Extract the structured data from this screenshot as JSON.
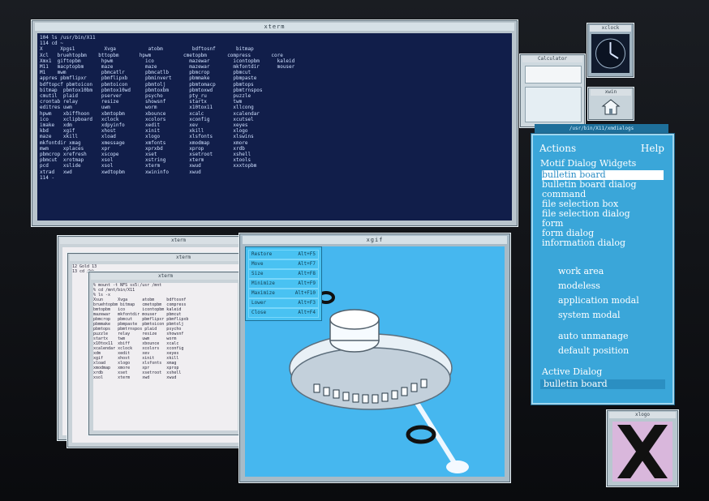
{
  "xterm_main": {
    "title": "xterm",
    "lines": [
      "104 ls /usr/bin/X11",
      "114 cd ~",
      "X      Xpgs1          Xvga           atobm          bdftosnf       bitmap",
      "Xcl   bruehtopbm    bttopbm       hpwm           cmetopbm       compress       core",
      "Xmx1  giftopbm       hpwm           ico            mazewar        icontopbm      kaleid",
      "M11   macptopbm      maze           maze           mazewar        mkfontdir      mouser",
      "M1    mwm            pbmcatlr       pbmcatlb       pbmcrop        pbmcut",
      "appres pbmflipxr     pbmflipxb      pbminvert      pbmmake        pbmpaste",
      "bdftopcf pbmtoicon   pbmtoicon      pbmtolj        pbmtomacp      pbmtops",
      "bitmap  pbmtox10bm   pbmtox10wd     pbmtoxbm       pbmtoxwd       pbmtrnspos",
      "cmutil  plaid        pserver        psycho         pty_ru         puzzle",
      "crontab relay        resize         showsnf        startx         twm",
      "editres uwm          uwm            worm           x10tox11       xllcong",
      "hpwm    xbiffhoon    xbmtopbm       xbounce        xcalc          xcalendar",
      "ico     xclipboard   xclock         xcolors        xconfig        xcutsel",
      "imake   xdm          xdpyinfo       xedit          xev            xeyes",
      "kbd     xgif         xhost          xinit          xkill          xlogo",
      "maze    xkill        xload          xlogo          xlsfonts       xlswins",
      "mkfontdir xmag       xmessage       xmfonts        xmodmap        xmore",
      "mwm     xplaces      xpr            xprxbd         xprop          xrdb",
      "pbmcrop xrefresh     xscope         xset           xsetroot       xshell",
      "pbmcut  xrotmap      xsol           xstring        xterm          xtools",
      "pcd     xslide       xsol           xterm          xwud           xxxtopbm",
      "xtrad   xwd          xwdtopbm       xwininfo       xwud",
      "114 -"
    ]
  },
  "clock": {
    "title": "xclock"
  },
  "calculator": {
    "title": "Calculator"
  },
  "small_tool": {
    "title": "xwin"
  },
  "motif_window": {
    "title": "/usr/bin/X11/xmdialogs",
    "menu_actions": "Actions",
    "menu_help": "Help",
    "section1": "Motif Dialog Widgets",
    "items": [
      "bulletin board",
      "bulletin board dialog",
      "command",
      "file selection box",
      "file selection dialog",
      "form",
      "form dialog",
      "information dialog"
    ],
    "options": [
      "work area",
      "modeless",
      "application modal",
      "system modal"
    ],
    "flags": [
      "auto unmanage",
      "default position"
    ],
    "active_label": "Active Dialog",
    "active_value": "bulletin board"
  },
  "xgif_window": {
    "title": "xgif",
    "menu": [
      {
        "label": "Restore",
        "key": "Alt+F5"
      },
      {
        "label": "Move",
        "key": "Alt+F7"
      },
      {
        "label": "Size",
        "key": "Alt+F8"
      },
      {
        "label": "Minimize",
        "key": "Alt+F9"
      },
      {
        "label": "Maximize",
        "key": "Alt+F10"
      },
      {
        "label": "Lower",
        "key": "Alt+F3"
      },
      {
        "label": "Close",
        "key": "Alt+F4"
      }
    ]
  },
  "left_terms": {
    "title_back": "xterm",
    "title_mid": "xterm",
    "title_front": "xterm",
    "mid_lines": [
      "12 Gold 13",
      "13 cd /bk"
    ],
    "front_lines": [
      "% mount -t NFS ss5:/usr /mnt",
      "% cd /mnt/bin/X11",
      "% ls -x",
      "Xsun      Xvga      atobm     bdftosnf",
      "bruehtopbm bitmap   cmetopbm  compress",
      "bmtopbm   ico       icontopbm kaleid",
      "mazewar   mkfontdir mouser    pbmcut",
      "pbmcrop   pbmcut    pbmflipxr pbmflipxb",
      "pbmmake   pbmpaste  pbmtoicon pbmtolj",
      "pbmtops   pbmtrnspos plaid    psycho",
      "puzzle    relay     resize    showsnf",
      "startx    twm       uwm       worm",
      "x10tox11  xbiff     xbounce   xcalc",
      "xcalendar xclock    xcolors   xconfig",
      "xdm       xedit     xev       xeyes",
      "xgif      xhost     xinit     xkill",
      "xload     xlogo     xlsfonts  xmag",
      "xmodmap   xmore     xpr       xprop",
      "xrdb      xset      xsetroot  xshell",
      "xsol      xterm     xwd       xwud"
    ]
  },
  "xlogo_window": {
    "title": "xlogo"
  }
}
